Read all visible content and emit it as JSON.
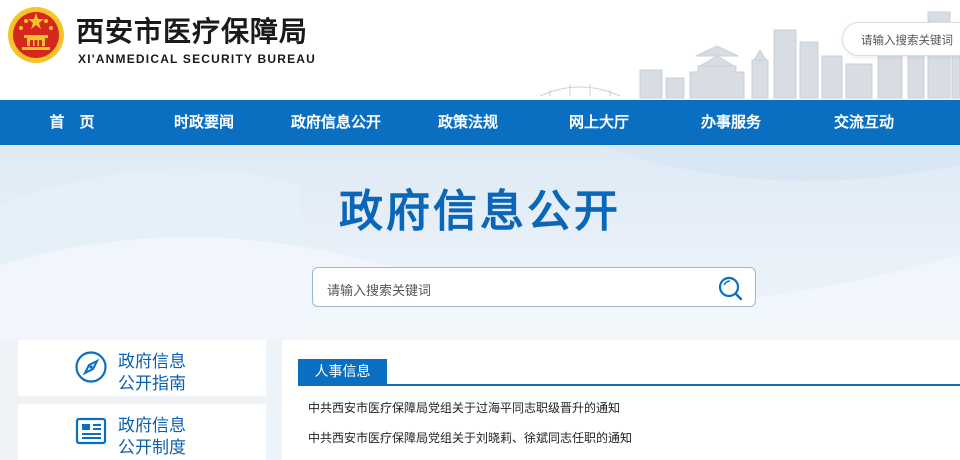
{
  "header": {
    "title": "西安市医疗保障局",
    "subtitle": "XI'ANMEDICAL SECURITY BUREAU",
    "search_placeholder": "请输入搜索关键词"
  },
  "nav": {
    "items": [
      {
        "label": "首　页"
      },
      {
        "label": "时政要闻"
      },
      {
        "label": "政府信息公开"
      },
      {
        "label": "政策法规"
      },
      {
        "label": "网上大厅"
      },
      {
        "label": "办事服务"
      },
      {
        "label": "交流互动"
      }
    ]
  },
  "banner": {
    "title": "政府信息公开",
    "search_placeholder": "请输入搜索关键词"
  },
  "sidebar": {
    "cards": [
      {
        "line1": "政府信息",
        "line2": "公开指南",
        "icon": "compass-icon"
      },
      {
        "line1": "政府信息",
        "line2": "公开制度",
        "icon": "document-icon"
      }
    ]
  },
  "news": {
    "tab_label": "人事信息",
    "items": [
      "中共西安市医疗保障局党组关于过海平同志职级晋升的通知",
      "中共西安市医疗保障局党组关于刘晓莉、徐斌同志任职的通知"
    ]
  },
  "colors": {
    "primary": "#0a6fc0",
    "title_blue": "#0a66b7",
    "emblem_red": "#d7261e",
    "emblem_gold": "#f6c427"
  }
}
